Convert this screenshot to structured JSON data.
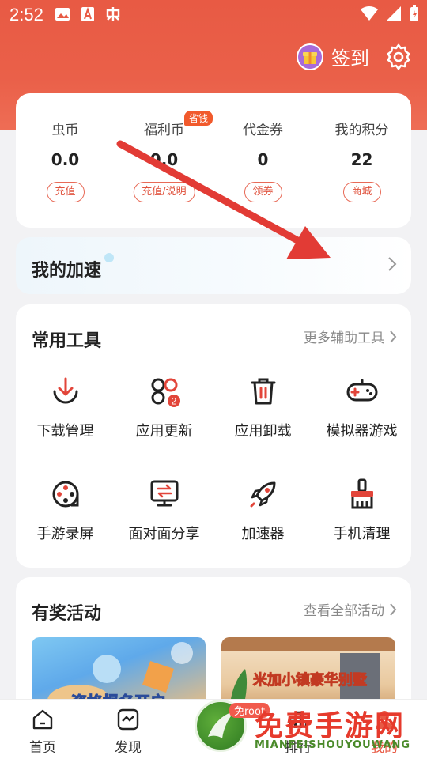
{
  "status_bar": {
    "time": "2:52"
  },
  "header": {
    "signin_label": "签到"
  },
  "wallet": [
    {
      "label": "虫币",
      "value": "0.0",
      "button": "充值"
    },
    {
      "label": "福利币",
      "value": "0.0",
      "button": "充值/说明",
      "badge": "省钱"
    },
    {
      "label": "代金券",
      "value": "0",
      "button": "领券"
    },
    {
      "label": "我的积分",
      "value": "22",
      "button": "商城"
    }
  ],
  "speed": {
    "title": "我的加速"
  },
  "tools": {
    "title": "常用工具",
    "more": "更多辅助工具",
    "items": [
      {
        "label": "下载管理",
        "icon": "download-icon"
      },
      {
        "label": "应用更新",
        "icon": "apps-update-icon",
        "badge": "2"
      },
      {
        "label": "应用卸载",
        "icon": "trash-icon"
      },
      {
        "label": "模拟器游戏",
        "icon": "gamepad-icon"
      },
      {
        "label": "手游录屏",
        "icon": "film-reel-icon"
      },
      {
        "label": "面对面分享",
        "icon": "transfer-icon"
      },
      {
        "label": "加速器",
        "icon": "rocket-icon"
      },
      {
        "label": "手机清理",
        "icon": "broom-icon"
      }
    ]
  },
  "activities": {
    "title": "有奖活动",
    "more": "查看全部活动",
    "banner1_text": "资格报名开启",
    "banner2_text": "米加小镇豪华别墅"
  },
  "nav": [
    {
      "label": "首页",
      "icon": "home-icon"
    },
    {
      "label": "发现",
      "icon": "discover-icon"
    },
    {
      "label": "排行",
      "icon": "rank-icon"
    },
    {
      "label": "我的",
      "icon": "profile-icon"
    }
  ],
  "watermark": {
    "title": "免费手游网",
    "sub": "MIANFEISHOUYOUWANG",
    "root_tag": "免root"
  },
  "colors": {
    "accent": "#e85a44",
    "arrow": "#e23b35"
  }
}
